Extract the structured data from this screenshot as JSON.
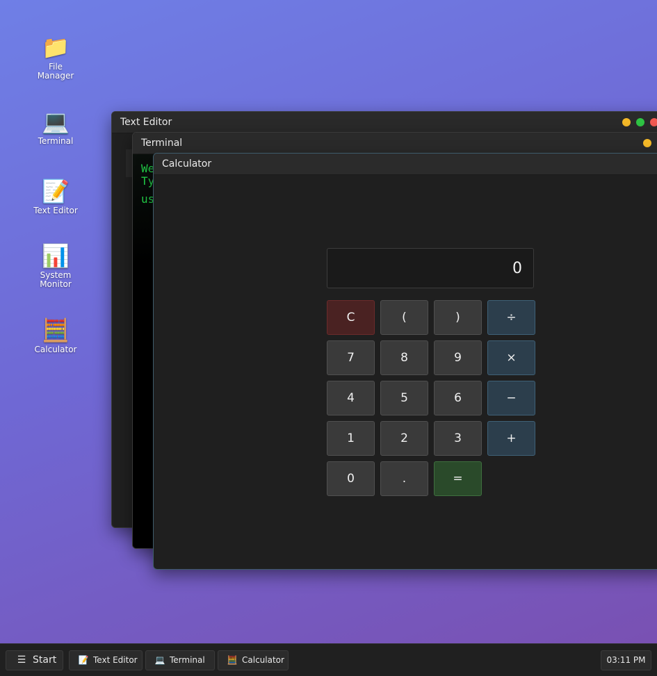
{
  "desktop": {
    "icons": [
      {
        "label": "File\nManager",
        "glyph": "📁",
        "icon_name": "folder-icon"
      },
      {
        "label": "Terminal",
        "glyph": "💻",
        "icon_name": "laptop-icon"
      },
      {
        "label": "Text Editor",
        "glyph": "📝",
        "icon_name": "memo-icon"
      },
      {
        "label": "System\nMonitor",
        "glyph": "📊",
        "icon_name": "bar-chart-icon"
      },
      {
        "label": "Calculator",
        "glyph": "🧮",
        "icon_name": "abacus-icon"
      }
    ]
  },
  "windows": {
    "text_editor": {
      "title": "Text Editor"
    },
    "terminal": {
      "title": "Terminal",
      "lines": [
        "We",
        "Ty",
        "us"
      ]
    },
    "calculator": {
      "title": "Calculator",
      "display": "0",
      "keys": {
        "clear": "C",
        "lparen": "(",
        "rparen": ")",
        "divide": "÷",
        "seven": "7",
        "eight": "8",
        "nine": "9",
        "multiply": "×",
        "four": "4",
        "five": "5",
        "six": "6",
        "minus": "−",
        "one": "1",
        "two": "2",
        "three": "3",
        "plus": "+",
        "zero": "0",
        "dot": ".",
        "equals": "="
      }
    }
  },
  "colors": {
    "minimize": "#f5b928",
    "maximize": "#2fc544",
    "close": "#f25a52",
    "terminal_text": "#23d44a"
  },
  "taskbar": {
    "start": {
      "label": "Start",
      "glyph": "☰"
    },
    "apps": [
      {
        "label": "Text Editor",
        "glyph": "📝"
      },
      {
        "label": "Terminal",
        "glyph": "💻"
      },
      {
        "label": "Calculator",
        "glyph": "🧮"
      }
    ],
    "clock": "03:11 PM"
  }
}
